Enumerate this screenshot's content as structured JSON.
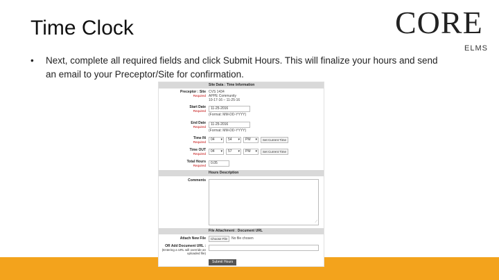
{
  "slide": {
    "title": "Time Clock",
    "bullet_symbol": "•",
    "bullet_text": "Next, complete all required fields and click Submit Hours. This will finalize your hours and send an email to your Preceptor/Site for confirmation."
  },
  "logo": {
    "main": "CORE",
    "sub": "ELMS"
  },
  "form": {
    "section_site": "Site Data : Time Information",
    "preceptor_label": "Preceptor : Site",
    "required": "Required",
    "preceptor_value_1": "CVS 1434",
    "preceptor_value_2": "APPE Community",
    "preceptor_value_3": "10-17-16 – 11-25-16",
    "start_label": "Start Date",
    "start_value": "11-25-2016",
    "start_hint": "(Format: MM-DD-YYYY)",
    "end_label": "End Date",
    "end_value": "11-25-2016",
    "end_hint": "(Format: MM-DD-YYYY)",
    "time_in_label": "Time IN",
    "time_in_hour": "04",
    "time_in_min": "54",
    "time_in_ampm": "PM",
    "time_out_label": "Time OUT",
    "time_out_hour": "04",
    "time_out_min": "57",
    "time_out_ampm": "PM",
    "set_current": "Set Current Time",
    "total_label": "Total Hours",
    "total_value": "0.05",
    "section_hours": "Hours Description",
    "comments_label": "Comments",
    "section_file": "File Attachment : Document URL",
    "attach_label": "Attach New File",
    "choose_file": "Choose File",
    "no_file": "No file chosen",
    "or_add_label": "OR Add Document URL :",
    "or_add_note": "(Entering a URL will override an uploaded file)",
    "submit_label": "Submit Hours"
  },
  "colors": {
    "accent_bar": "#f3a31c",
    "required_text": "#c00000"
  }
}
